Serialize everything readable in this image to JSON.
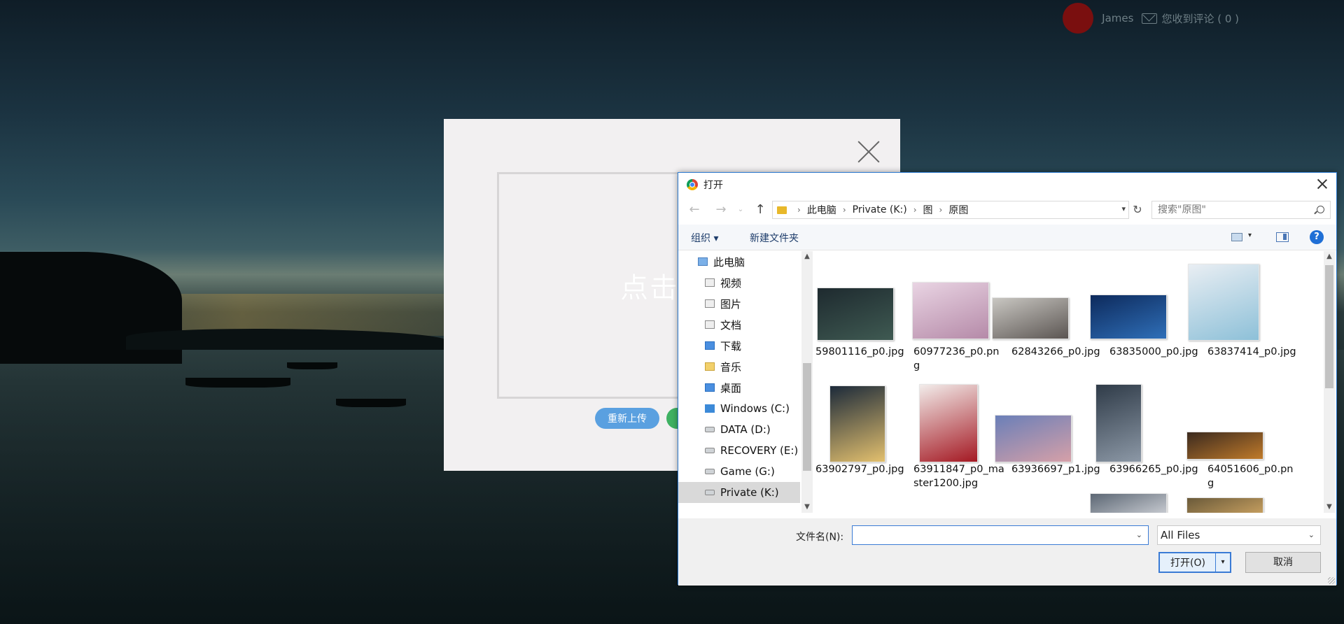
{
  "topbar": {
    "username": "James",
    "comments_label": "您收到评论 ( 0 )",
    "mail_icon": "mail-icon"
  },
  "upload_modal": {
    "drop_label": "点击上传",
    "reupload_label": "重新上传"
  },
  "open_dialog": {
    "title": "打开",
    "breadcrumbs": [
      "此电脑",
      "Private (K:)",
      "图",
      "原图"
    ],
    "search_placeholder": "搜索\"原图\"",
    "toolbar": {
      "organize_label": "组织 ▾",
      "new_folder_label": "新建文件夹"
    },
    "nav_items": [
      {
        "label": "此电脑",
        "icon": "pc"
      },
      {
        "label": "视频",
        "icon": "video"
      },
      {
        "label": "图片",
        "icon": "pictures"
      },
      {
        "label": "文档",
        "icon": "documents"
      },
      {
        "label": "下载",
        "icon": "downloads"
      },
      {
        "label": "音乐",
        "icon": "music"
      },
      {
        "label": "桌面",
        "icon": "desktop"
      },
      {
        "label": "Windows (C:)",
        "icon": "windows-drive"
      },
      {
        "label": "DATA (D:)",
        "icon": "drive"
      },
      {
        "label": "RECOVERY (E:)",
        "icon": "drive"
      },
      {
        "label": "Game (G:)",
        "icon": "drive"
      },
      {
        "label": "Private (K:)",
        "icon": "drive",
        "selected": true
      }
    ],
    "files": [
      {
        "name": "59801116_p0.jpg",
        "colors": [
          "#1e2a2f",
          "#3f5a52"
        ]
      },
      {
        "name": "60977236_p0.png",
        "colors": [
          "#e9d4e3",
          "#b58aa8"
        ]
      },
      {
        "name": "62843266_p0.jpg",
        "colors": [
          "#c9c7c2",
          "#5b5552"
        ]
      },
      {
        "name": "63835000_p0.jpg",
        "colors": [
          "#0d2a5c",
          "#2f6fb8"
        ]
      },
      {
        "name": "63837414_p0.jpg",
        "colors": [
          "#e9eef3",
          "#8dc0d8"
        ]
      },
      {
        "name": "63902797_p0.jpg",
        "colors": [
          "#1c2a3a",
          "#e3c06e"
        ]
      },
      {
        "name": "63911847_p0_master1200.jpg",
        "colors": [
          "#f2ecea",
          "#a41822"
        ]
      },
      {
        "name": "63936697_p1.jpg",
        "colors": [
          "#6a7fb8",
          "#d6a0a8"
        ]
      },
      {
        "name": "63966265_p0.jpg",
        "colors": [
          "#2f3b48",
          "#8c98a6"
        ]
      },
      {
        "name": "64051606_p0.png",
        "colors": [
          "#3b2a1f",
          "#c07a2a"
        ]
      }
    ],
    "filename_label": "文件名(N):",
    "filename_value": "",
    "filter_value": "All Files",
    "open_label": "打开(O)",
    "cancel_label": "取消"
  }
}
